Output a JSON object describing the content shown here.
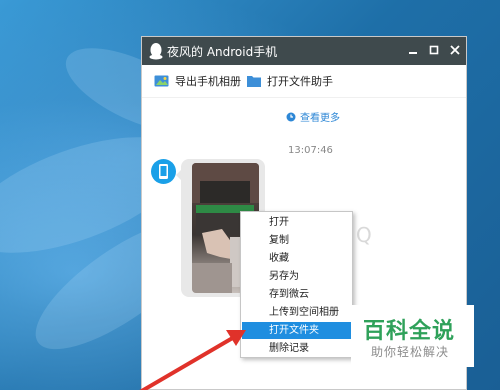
{
  "window": {
    "title": "夜风的 Android手机",
    "controls": [
      "minimize",
      "maximize",
      "close"
    ]
  },
  "toolbar": {
    "export_label": "导出手机相册",
    "open_helper_label": "打开文件助手"
  },
  "chat": {
    "view_more": "查看更多",
    "timestamp": "13:07:46"
  },
  "context_menu": {
    "items": [
      "打开",
      "复制",
      "收藏",
      "另存为",
      "存到微云",
      "上传到空间相册",
      "打开文件夹",
      "删除记录"
    ],
    "selected_item": "打开文件夹"
  },
  "watermark": {
    "title": "百科全说",
    "subtitle": "助你轻松解决"
  },
  "colors": {
    "titlebar": "#3f4a4d",
    "accent_blue": "#1f8ee0",
    "arrow_red": "#e0322a",
    "watermark_green": "#2fa15a"
  }
}
